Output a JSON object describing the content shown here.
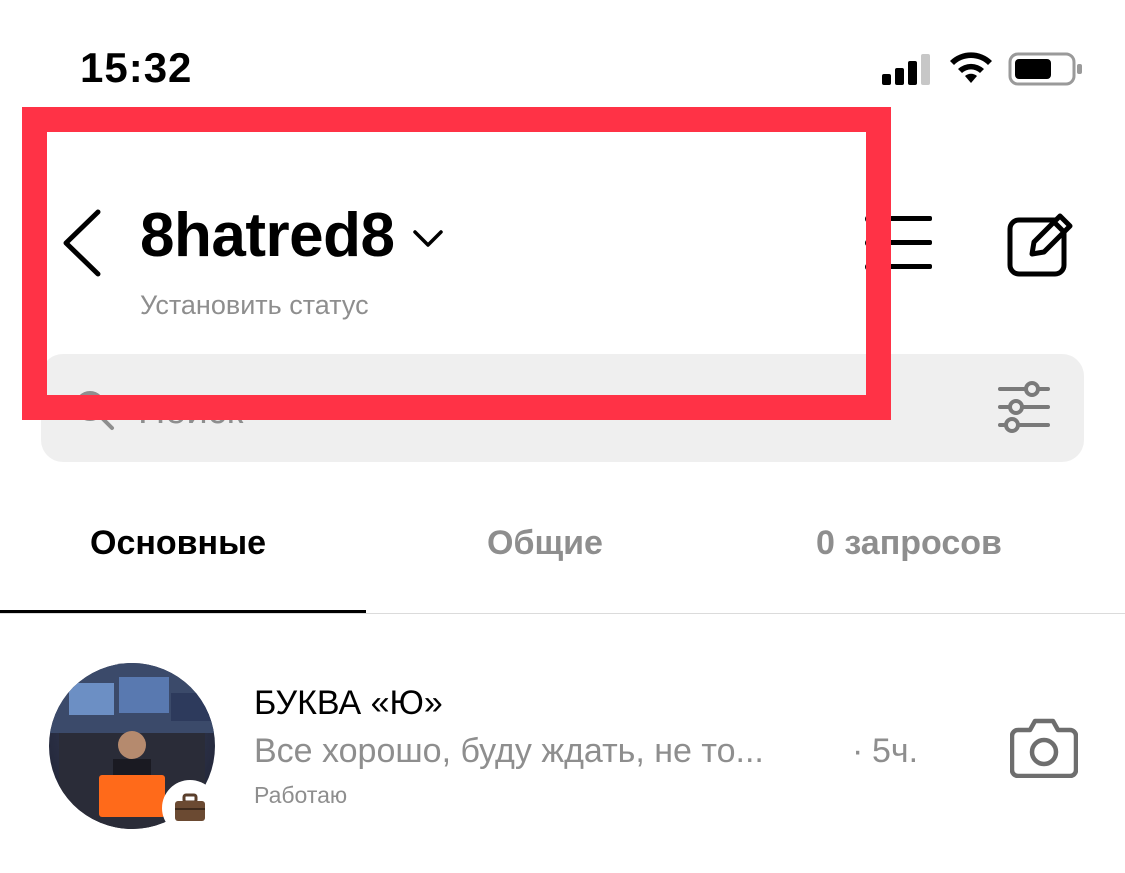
{
  "status_bar": {
    "time": "15:32",
    "icons": [
      "cellular-signal-icon",
      "wifi-icon",
      "battery-icon"
    ]
  },
  "header": {
    "back_icon": "chevron-left-icon",
    "username": "8hatred8",
    "account_switch_icon": "chevron-down-icon",
    "status_hint": "Установить статус",
    "menu_icon": "list-menu-icon",
    "compose_icon": "compose-icon"
  },
  "search": {
    "placeholder": "Поиск",
    "icon": "search-icon",
    "filter_icon": "filter-sliders-icon"
  },
  "tabs": [
    {
      "label": "Основные",
      "active": true
    },
    {
      "label": "Общие",
      "active": false
    },
    {
      "label": "0 запросов",
      "active": false
    }
  ],
  "conversations": [
    {
      "name": "БУКВА «Ю»",
      "last_message": "Все хорошо, буду ждать, не то...",
      "separator": "·",
      "time": "5ч.",
      "status": "Работаю",
      "badge_icon": "briefcase-icon",
      "action_icon": "camera-icon"
    }
  ],
  "colors": {
    "highlight": "#ff3246",
    "search_bg": "#efefef",
    "muted_text": "#8e8e8e"
  }
}
